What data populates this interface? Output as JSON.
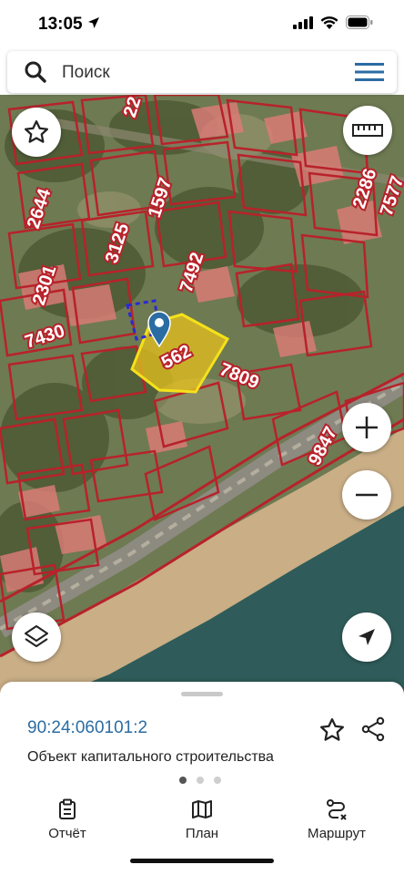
{
  "status": {
    "time": "13:05"
  },
  "search": {
    "placeholder": "Поиск"
  },
  "map": {
    "labels": {
      "l2644": "2644",
      "l3125": "3125",
      "l1597": "1597",
      "l2301": "2301",
      "l7492": "7492",
      "l7430": "7430",
      "l2286": "2286",
      "l7577": "7577",
      "l7809": "7809",
      "l9847": "9847",
      "l562": "562",
      "l22": "22"
    }
  },
  "sheet": {
    "cadastral_number": "90:24:060101:2",
    "object_type": "Объект капитального строительства"
  },
  "tabs": {
    "report": "Отчёт",
    "plan": "План",
    "route": "Маршрут"
  }
}
